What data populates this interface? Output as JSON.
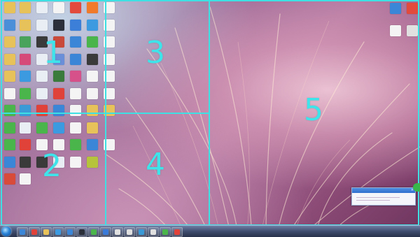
{
  "regions": [
    "1",
    "2",
    "3",
    "4",
    "5"
  ],
  "colors": {
    "accent": "#3fe0e4",
    "taskbar": "#3e4c6d"
  },
  "desktop_icons": [
    {
      "icon": "folder-icon",
      "color": "#e7c25a"
    },
    {
      "icon": "folder-icon",
      "color": "#e7c25a"
    },
    {
      "icon": "document-icon",
      "color": "#e9eef4"
    },
    {
      "icon": "spreadsheet-icon",
      "color": "#f4f4f4"
    },
    {
      "icon": "app-icon",
      "color": "#e24a3b"
    },
    {
      "icon": "app-icon",
      "color": "#f07a2a"
    },
    {
      "icon": "document-icon",
      "color": "#f4f4f4"
    },
    {
      "icon": "computer-icon",
      "color": "#4a8fd8"
    },
    {
      "icon": "folder-icon",
      "color": "#e7c25a"
    },
    {
      "icon": "document-icon",
      "color": "#e9eef4"
    },
    {
      "icon": "app-icon",
      "color": "#2a2f3a"
    },
    {
      "icon": "app-icon",
      "color": "#3b7fd8"
    },
    {
      "icon": "app-icon",
      "color": "#3b9ae0"
    },
    {
      "icon": "document-icon",
      "color": "#f4f4f4"
    },
    {
      "icon": "folder-icon",
      "color": "#e7c25a"
    },
    {
      "icon": "app-icon",
      "color": "#4aa35a"
    },
    {
      "icon": "app-icon",
      "color": "#3a3a3a"
    },
    {
      "icon": "app-icon",
      "color": "#c94a3b"
    },
    {
      "icon": "app-icon",
      "color": "#3b86d6"
    },
    {
      "icon": "app-icon",
      "color": "#4ab54a"
    },
    {
      "icon": "document-icon",
      "color": "#f4f4f4"
    },
    {
      "icon": "folder-icon",
      "color": "#e7c25a"
    },
    {
      "icon": "app-icon",
      "color": "#d64a7a"
    },
    {
      "icon": "document-icon",
      "color": "#e9eef4"
    },
    {
      "icon": "app-icon",
      "color": "#6a8fd8"
    },
    {
      "icon": "gear-icon",
      "color": "#3b86d6"
    },
    {
      "icon": "app-icon",
      "color": "#3a3a3a"
    },
    {
      "icon": "document-icon",
      "color": "#f4f4f4"
    },
    {
      "icon": "folder-icon",
      "color": "#e7c25a"
    },
    {
      "icon": "ie-icon",
      "color": "#3b9ae0"
    },
    {
      "icon": "document-icon",
      "color": "#e9eef4"
    },
    {
      "icon": "app-icon",
      "color": "#3a7a3a"
    },
    {
      "icon": "app-icon",
      "color": "#d6508a"
    },
    {
      "icon": "document-icon",
      "color": "#f4f4f4"
    },
    {
      "icon": "document-icon",
      "color": "#f4f4f4"
    },
    {
      "icon": "spreadsheet-icon",
      "color": "#f4f4f4"
    },
    {
      "icon": "app-icon",
      "color": "#4ab54a"
    },
    {
      "icon": "document-icon",
      "color": "#e9eef4"
    },
    {
      "icon": "app-icon",
      "color": "#e0423a"
    },
    {
      "icon": "document-icon",
      "color": "#f4f4f4"
    },
    {
      "icon": "document-icon",
      "color": "#f4f4f4"
    },
    {
      "icon": "document-icon",
      "color": "#f4f4f4"
    },
    {
      "icon": "app-icon",
      "color": "#4ab54a"
    },
    {
      "icon": "app-icon",
      "color": "#3a9ad8"
    },
    {
      "icon": "app-icon",
      "color": "#e0423a"
    },
    {
      "icon": "app-icon",
      "color": "#3b86d6"
    },
    {
      "icon": "document-icon",
      "color": "#f4f4f4"
    },
    {
      "icon": "folder-icon",
      "color": "#e7c25a"
    },
    {
      "icon": "folder-icon",
      "color": "#e7c25a"
    },
    {
      "icon": "app-icon",
      "color": "#4ab54a"
    },
    {
      "icon": "document-icon",
      "color": "#e9eef4"
    },
    {
      "icon": "app-icon",
      "color": "#4ab54a"
    },
    {
      "icon": "ie-icon",
      "color": "#3b9ae0"
    },
    {
      "icon": "document-icon",
      "color": "#f4f4f4"
    },
    {
      "icon": "folder-icon",
      "color": "#e7c25a"
    },
    {
      "icon": "app-icon",
      "color": "#4ab54a"
    },
    {
      "icon": "app-icon",
      "color": "#e0423a"
    },
    {
      "icon": "spreadsheet-icon",
      "color": "#f4f4f4"
    },
    {
      "icon": "spreadsheet-icon",
      "color": "#f4f4f4"
    },
    {
      "icon": "app-icon",
      "color": "#4ab54a"
    },
    {
      "icon": "app-icon",
      "color": "#3b86d6"
    },
    {
      "icon": "document-icon",
      "color": "#f4f4f4"
    },
    {
      "icon": "app-icon",
      "color": "#3b86d6"
    },
    {
      "icon": "app-icon",
      "color": "#3a3a3a"
    },
    {
      "icon": "app-icon",
      "color": "#3a3a3a"
    },
    {
      "icon": "document-icon",
      "color": "#e9eef4"
    },
    {
      "icon": "spreadsheet-icon",
      "color": "#f4f4f4"
    },
    {
      "icon": "app-icon",
      "color": "#b5c43a"
    },
    {
      "icon": "app-icon",
      "color": "#d84a3a"
    },
    {
      "icon": "document-icon",
      "color": "#f4f4f4"
    },
    {
      "icon": "app-icon",
      "color": "#3b86d6"
    },
    {
      "icon": "app-icon",
      "color": "#e24a3b"
    },
    {
      "icon": "document-icon",
      "color": "#f4f4f4"
    },
    {
      "icon": "app-icon",
      "color": "#e0e0e0"
    }
  ],
  "taskbar": {
    "start": "start-orb-icon",
    "buttons": [
      {
        "icon": "media-icon",
        "color": "#3b86d6"
      },
      {
        "icon": "browser-icon",
        "color": "#e0423a"
      },
      {
        "icon": "folder-icon",
        "color": "#e7c25a"
      },
      {
        "icon": "app-icon",
        "color": "#3b9ae0"
      },
      {
        "icon": "app-icon",
        "color": "#3b86d6"
      },
      {
        "icon": "app-icon",
        "color": "#2a2f3a"
      },
      {
        "icon": "app-icon",
        "color": "#4ab54a"
      },
      {
        "icon": "app-icon",
        "color": "#3a7ad8"
      },
      {
        "icon": "app-icon",
        "color": "#e0e0e0"
      },
      {
        "icon": "app-icon",
        "color": "#e0e0e0"
      },
      {
        "icon": "app-icon",
        "color": "#3a9ad8"
      },
      {
        "icon": "app-icon",
        "color": "#e0e0e0"
      },
      {
        "icon": "app-icon",
        "color": "#4ab54a"
      },
      {
        "icon": "app-icon",
        "color": "#e0423a"
      }
    ]
  }
}
